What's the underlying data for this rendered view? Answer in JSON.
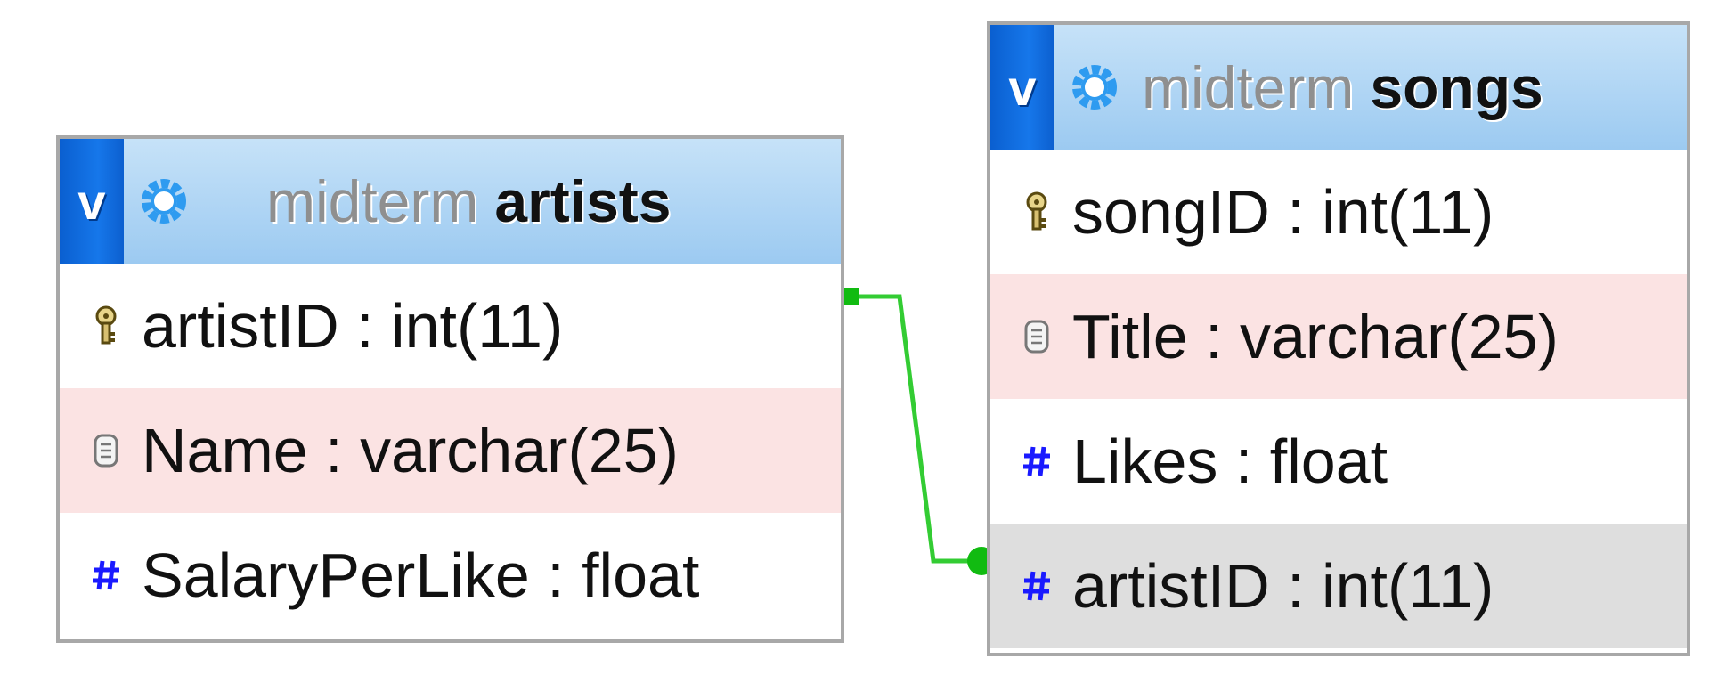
{
  "tables": {
    "artists": {
      "toggle_label": "v",
      "database": "midterm",
      "name": "artists",
      "columns": [
        {
          "text": "artistID : int(11)",
          "icon": "primary-key-icon"
        },
        {
          "text": "Name : varchar(25)",
          "icon": "text-field-icon"
        },
        {
          "text": "SalaryPerLike : float",
          "icon": "numeric-hash-icon"
        }
      ]
    },
    "songs": {
      "toggle_label": "v",
      "database": "midterm",
      "name": "songs",
      "columns": [
        {
          "text": "songID : int(11)",
          "icon": "primary-key-icon"
        },
        {
          "text": "Title : varchar(25)",
          "icon": "text-field-icon"
        },
        {
          "text": "Likes : float",
          "icon": "numeric-hash-icon"
        },
        {
          "text": "artistID : int(11)",
          "icon": "numeric-hash-icon"
        }
      ]
    }
  },
  "colors": {
    "header_gradient_top": "#c6e2f8",
    "header_gradient_bottom": "#9ccaf1",
    "toggle_blue": "#1677ea",
    "alt_row": "#fbe3e3",
    "fk_row": "#dedede",
    "relation_line": "#33cc33",
    "border": "#a8a8a8"
  }
}
